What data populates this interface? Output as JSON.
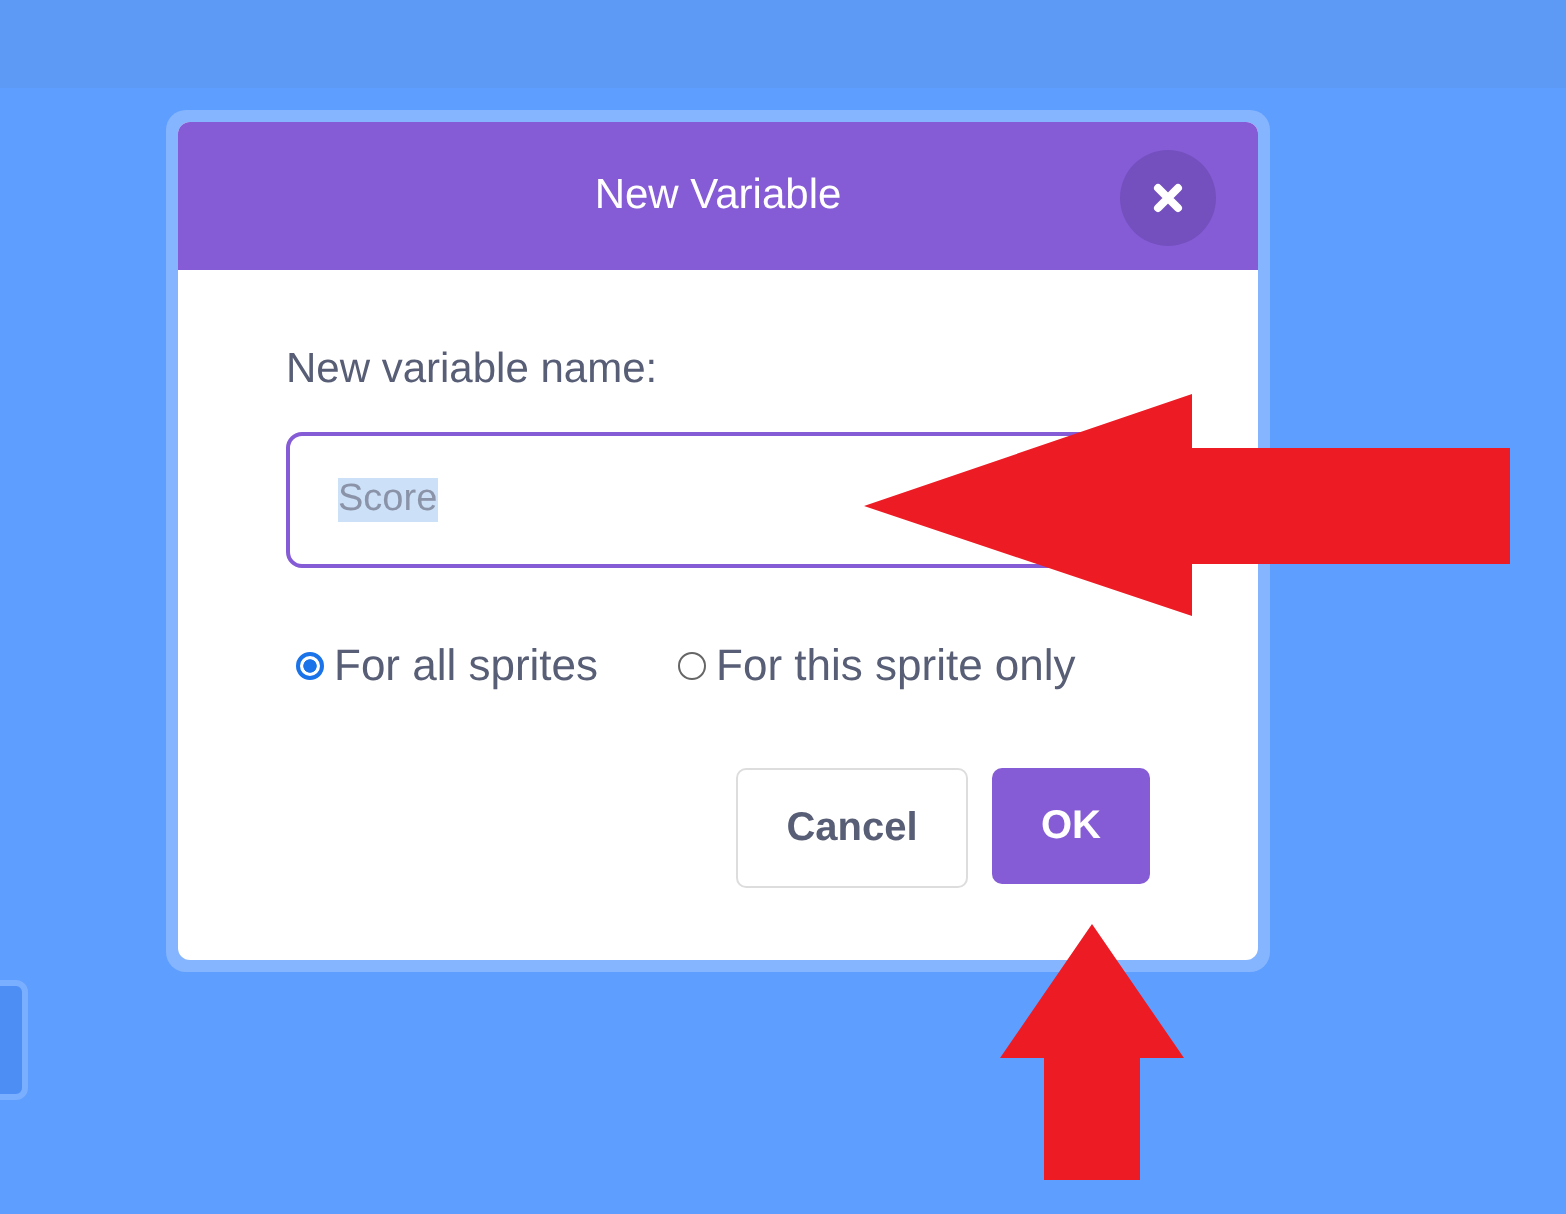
{
  "dialog": {
    "title": "New Variable",
    "field_label": "New variable name:",
    "field": {
      "value": "Score",
      "text_selected": true
    },
    "scope_options": [
      {
        "label": "For all sprites",
        "selected": true
      },
      {
        "label": "For this sprite only",
        "selected": false
      }
    ],
    "buttons": [
      {
        "label": "Cancel",
        "kind": "secondary"
      },
      {
        "label": "OK",
        "kind": "primary"
      }
    ]
  }
}
